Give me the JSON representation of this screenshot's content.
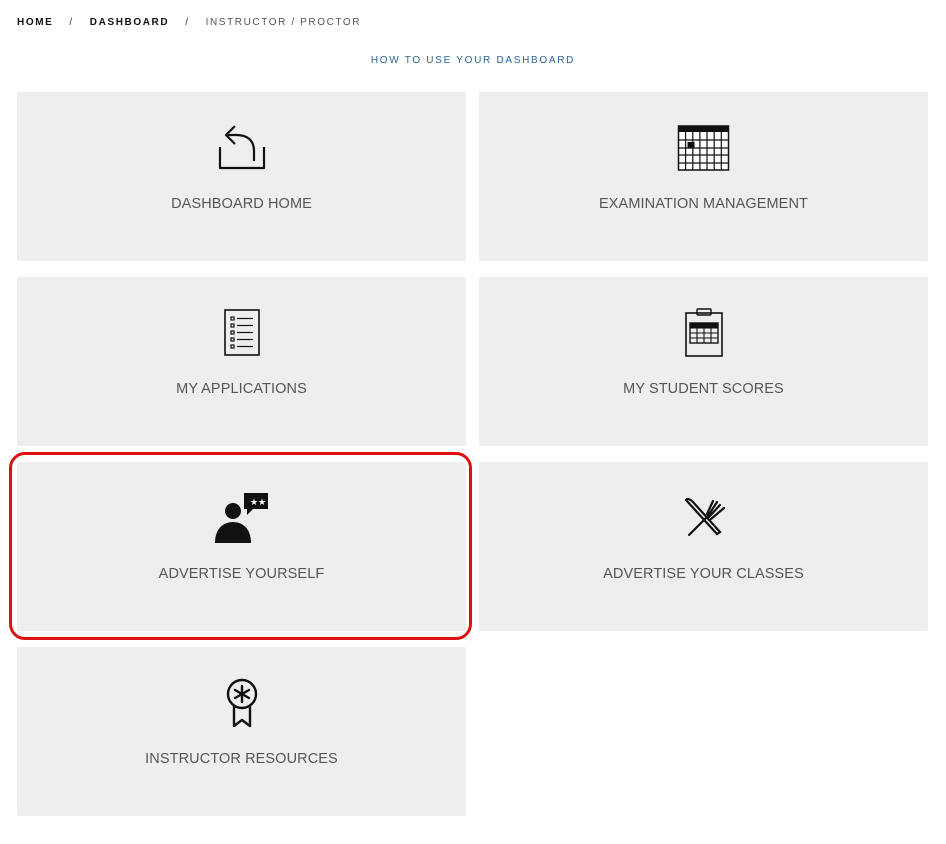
{
  "breadcrumb": {
    "home": "HOME",
    "dashboard": "DASHBOARD",
    "current": "INSTRUCTOR / PROCTOR",
    "separator": "/"
  },
  "howto_link": "HOW TO USE YOUR DASHBOARD",
  "tiles": [
    {
      "label": "DASHBOARD HOME",
      "icon": "return-tray-icon"
    },
    {
      "label": "EXAMINATION MANAGEMENT",
      "icon": "calendar-icon"
    },
    {
      "label": "MY APPLICATIONS",
      "icon": "checklist-icon"
    },
    {
      "label": "MY STUDENT SCORES",
      "icon": "clipboard-grid-icon"
    },
    {
      "label": "ADVERTISE YOURSELF",
      "icon": "person-review-icon"
    },
    {
      "label": "ADVERTISE YOUR CLASSES",
      "icon": "crossed-tools-icon"
    },
    {
      "label": "INSTRUCTOR RESOURCES",
      "icon": "award-ribbon-icon"
    }
  ],
  "highlight_color": "#dd1111",
  "tile_color": "#eeeeee",
  "link_color": "#2a6496"
}
